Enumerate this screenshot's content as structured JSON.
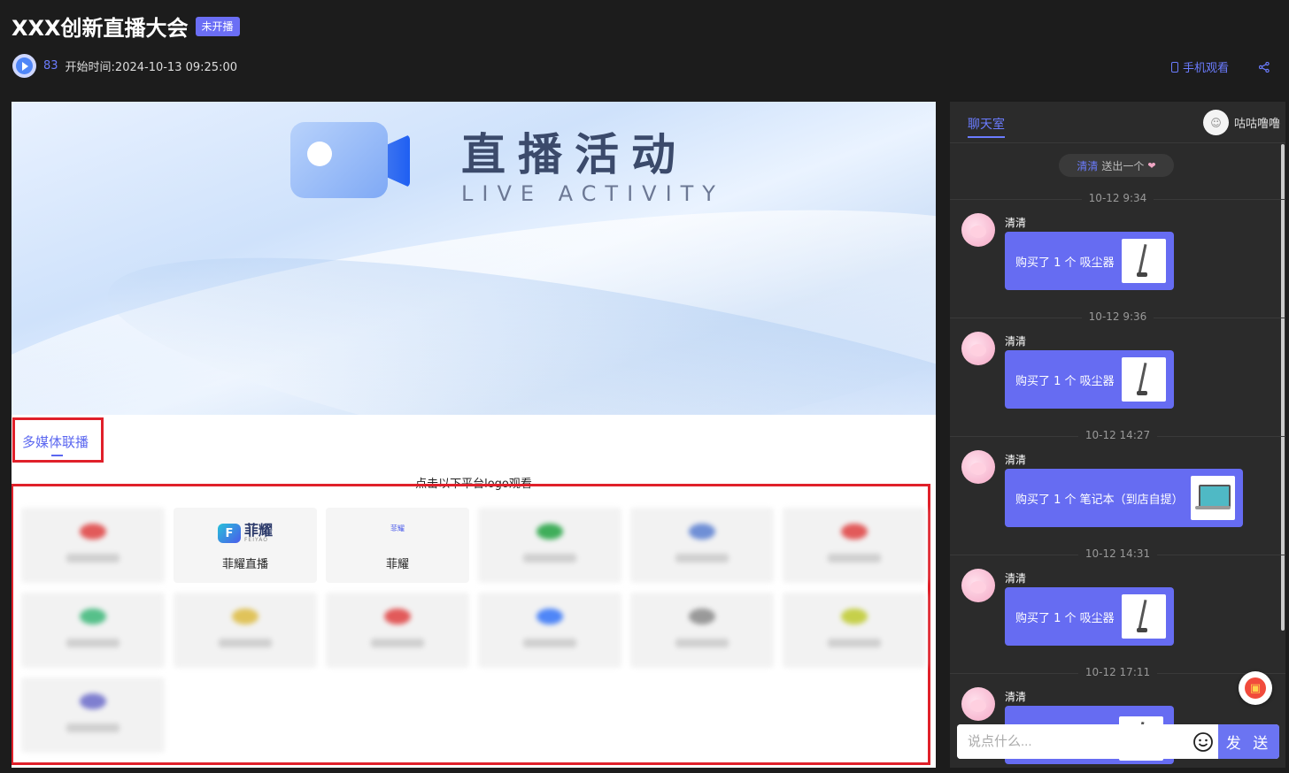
{
  "header": {
    "title": "XXX创新直播大会",
    "status_badge": "未开播",
    "viewers": "83",
    "start_time": "开始时间:2024-10-13 09:25:00",
    "mobile_watch": "手机观看"
  },
  "banner": {
    "title": "直播活动",
    "subtitle": "LIVE ACTIVITY"
  },
  "multimedia": {
    "tab_label": "多媒体联播",
    "hint": "点击以下平台logo观看",
    "platforms": [
      {
        "name": "",
        "blurred": true,
        "color": "#e25a5a"
      },
      {
        "name": "菲耀直播",
        "blurred": false,
        "logo_text": "菲耀",
        "logo_sub": "FEIYAO"
      },
      {
        "name": "菲耀",
        "blurred": false,
        "logo_text": "菲耀"
      },
      {
        "name": "",
        "blurred": true,
        "color": "#3fae5a"
      },
      {
        "name": "",
        "blurred": true,
        "color": "#6f8fd6"
      },
      {
        "name": "",
        "blurred": true,
        "color": "#e25a5a"
      },
      {
        "name": "",
        "blurred": true,
        "color": "#56c08a"
      },
      {
        "name": "",
        "blurred": true,
        "color": "#e0c35a"
      },
      {
        "name": "",
        "blurred": true,
        "color": "#e25a5a"
      },
      {
        "name": "",
        "blurred": true,
        "color": "#4f86f7"
      },
      {
        "name": "",
        "blurred": true,
        "color": "#999999"
      },
      {
        "name": "",
        "blurred": true,
        "color": "#c6d04a"
      },
      {
        "name": "",
        "blurred": true,
        "color": "#7f7fd0"
      }
    ]
  },
  "chat": {
    "tab_label": "聊天室",
    "username": "咕咕噜噜",
    "gift_notice": {
      "who": "清清",
      "text": "送出一个"
    },
    "messages": [
      {
        "time": "10-12 9:34",
        "name": "清清",
        "text": "购买了 1 个 吸尘器",
        "product": "vacuum"
      },
      {
        "time": "10-12 9:36",
        "name": "清清",
        "text": "购买了 1 个 吸尘器",
        "product": "vacuum"
      },
      {
        "time": "10-12 14:27",
        "name": "清清",
        "text": "购买了 1 个 笔记本（到店自提）",
        "product": "laptop"
      },
      {
        "time": "10-12 14:31",
        "name": "清清",
        "text": "购买了 1 个 吸尘器",
        "product": "vacuum"
      },
      {
        "time": "10-12 17:11",
        "name": "清清",
        "text": "",
        "product": "vacuum"
      }
    ],
    "input_placeholder": "说点什么...",
    "send_label": "发 送"
  }
}
